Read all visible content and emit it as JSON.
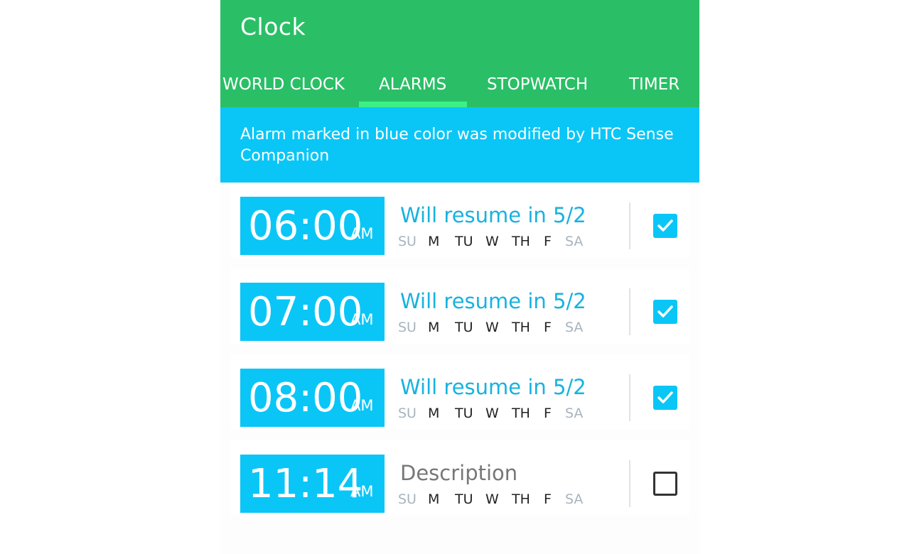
{
  "app": {
    "title": "Clock"
  },
  "tabs": [
    {
      "label": "WORLD CLOCK"
    },
    {
      "label": "ALARMS"
    },
    {
      "label": "STOPWATCH"
    },
    {
      "label": "TIMER"
    }
  ],
  "active_tab": "ALARMS",
  "banner": {
    "text": "Alarm marked in blue color was modified by HTC Sense Companion"
  },
  "colors": {
    "app_bar": "#2abf66",
    "tab_indicator": "#3cf088",
    "accent_blue": "#0ac6f7",
    "label_blue": "#17b2e0"
  },
  "day_labels": [
    "SU",
    "M",
    "TU",
    "W",
    "TH",
    "F",
    "SA"
  ],
  "alarms": [
    {
      "time": "06:00",
      "ampm": "AM",
      "label": "Will resume in 5/2",
      "enabled": true,
      "days_active": [
        false,
        true,
        true,
        true,
        true,
        true,
        false
      ]
    },
    {
      "time": "07:00",
      "ampm": "AM",
      "label": "Will resume in 5/2",
      "enabled": true,
      "days_active": [
        false,
        true,
        true,
        true,
        true,
        true,
        false
      ]
    },
    {
      "time": "08:00",
      "ampm": "AM",
      "label": "Will resume in 5/2",
      "enabled": true,
      "days_active": [
        false,
        true,
        true,
        true,
        true,
        true,
        false
      ]
    },
    {
      "time": "11:14",
      "ampm": "AM",
      "label": "Description",
      "enabled": false,
      "days_active": [
        false,
        true,
        true,
        true,
        true,
        true,
        false
      ]
    }
  ]
}
